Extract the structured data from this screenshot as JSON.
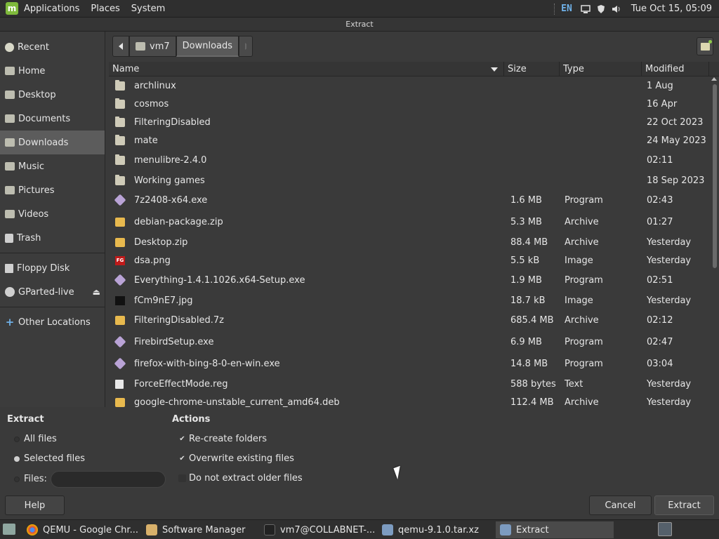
{
  "top_panel": {
    "menus": [
      "Applications",
      "Places",
      "System"
    ],
    "keyboard_layout": "EN",
    "clock": "Tue Oct 15, 05:09"
  },
  "window": {
    "title": "Extract"
  },
  "sidebar": {
    "items": [
      {
        "label": "Recent",
        "icon": "recent-icon"
      },
      {
        "label": "Home",
        "icon": "home-icon"
      },
      {
        "label": "Desktop",
        "icon": "desktop-icon"
      },
      {
        "label": "Documents",
        "icon": "documents-icon"
      },
      {
        "label": "Downloads",
        "icon": "downloads-icon",
        "active": true
      },
      {
        "label": "Music",
        "icon": "music-icon"
      },
      {
        "label": "Pictures",
        "icon": "pictures-icon"
      },
      {
        "label": "Videos",
        "icon": "videos-icon"
      },
      {
        "label": "Trash",
        "icon": "trash-icon"
      }
    ],
    "devices": [
      {
        "label": "Floppy Disk",
        "icon": "floppy-icon"
      },
      {
        "label": "GParted-live",
        "icon": "disk-icon",
        "eject": true
      }
    ],
    "other": {
      "label": "Other Locations",
      "icon": "plus-icon"
    }
  },
  "pathbar": {
    "segments": [
      "vm7",
      "Downloads"
    ],
    "active": "Downloads"
  },
  "columns": {
    "name": "Name",
    "size": "Size",
    "type": "Type",
    "modified": "Modified"
  },
  "files": [
    {
      "name": "archlinux",
      "size": "",
      "type": "",
      "modified": "1 Aug",
      "kind": "folder"
    },
    {
      "name": "cosmos",
      "size": "",
      "type": "",
      "modified": "16 Apr",
      "kind": "folder"
    },
    {
      "name": "FilteringDisabled",
      "size": "",
      "type": "",
      "modified": "22 Oct 2023",
      "kind": "folder"
    },
    {
      "name": "mate",
      "size": "",
      "type": "",
      "modified": "24 May 2023",
      "kind": "folder"
    },
    {
      "name": "menulibre-2.4.0",
      "size": "",
      "type": "",
      "modified": "02:11",
      "kind": "folder"
    },
    {
      "name": "Working games",
      "size": "",
      "type": "",
      "modified": "18 Sep 2023",
      "kind": "folder"
    },
    {
      "name": "7z2408-x64.exe",
      "size": "1.6 MB",
      "type": "Program",
      "modified": "02:43",
      "kind": "exe"
    },
    {
      "name": "debian-package.zip",
      "size": "5.3 MB",
      "type": "Archive",
      "modified": "01:27",
      "kind": "archive"
    },
    {
      "name": "Desktop.zip",
      "size": "88.4 MB",
      "type": "Archive",
      "modified": "Yesterday",
      "kind": "archive"
    },
    {
      "name": "dsa.png",
      "size": "5.5 kB",
      "type": "Image",
      "modified": "Yesterday",
      "kind": "image-red",
      "badge": "FG"
    },
    {
      "name": "Everything-1.4.1.1026.x64-Setup.exe",
      "size": "1.9 MB",
      "type": "Program",
      "modified": "02:51",
      "kind": "exe"
    },
    {
      "name": "fCm9nE7.jpg",
      "size": "18.7 kB",
      "type": "Image",
      "modified": "Yesterday",
      "kind": "image-dark"
    },
    {
      "name": "FilteringDisabled.7z",
      "size": "685.4 MB",
      "type": "Archive",
      "modified": "02:12",
      "kind": "archive"
    },
    {
      "name": "FirebirdSetup.exe",
      "size": "6.9 MB",
      "type": "Program",
      "modified": "02:47",
      "kind": "exe"
    },
    {
      "name": "firefox-with-bing-8-0-en-win.exe",
      "size": "14.8 MB",
      "type": "Program",
      "modified": "03:04",
      "kind": "exe"
    },
    {
      "name": "ForceEffectMode.reg",
      "size": "588 bytes",
      "type": "Text",
      "modified": "Yesterday",
      "kind": "text"
    },
    {
      "name": "google-chrome-unstable_current_amd64.deb",
      "size": "112.4 MB",
      "type": "Archive",
      "modified": "Yesterday",
      "kind": "archive"
    }
  ],
  "extract_options": {
    "heading": "Extract",
    "all_files": "All files",
    "selected_files": "Selected files",
    "files_label": "Files:",
    "files_value": "",
    "selected": "selected_files"
  },
  "actions": {
    "heading": "Actions",
    "recreate_folders": {
      "label": "Re-create folders",
      "checked": true
    },
    "overwrite_existing": {
      "label": "Overwrite existing files",
      "checked": true
    },
    "do_not_extract_older": {
      "label": "Do not extract older files",
      "checked": false
    }
  },
  "buttons": {
    "help": "Help",
    "cancel": "Cancel",
    "extract": "Extract"
  },
  "taskbar": {
    "items": [
      {
        "label": "QEMU - Google Chr...",
        "icon": "chrome-icon"
      },
      {
        "label": "Software Manager",
        "icon": "software-manager-icon"
      },
      {
        "label": "vm7@COLLABNET-...",
        "icon": "terminal-icon"
      },
      {
        "label": "qemu-9.1.0.tar.xz",
        "icon": "archive-manager-icon"
      },
      {
        "label": "Extract",
        "icon": "archive-manager-icon",
        "active": true
      }
    ]
  }
}
